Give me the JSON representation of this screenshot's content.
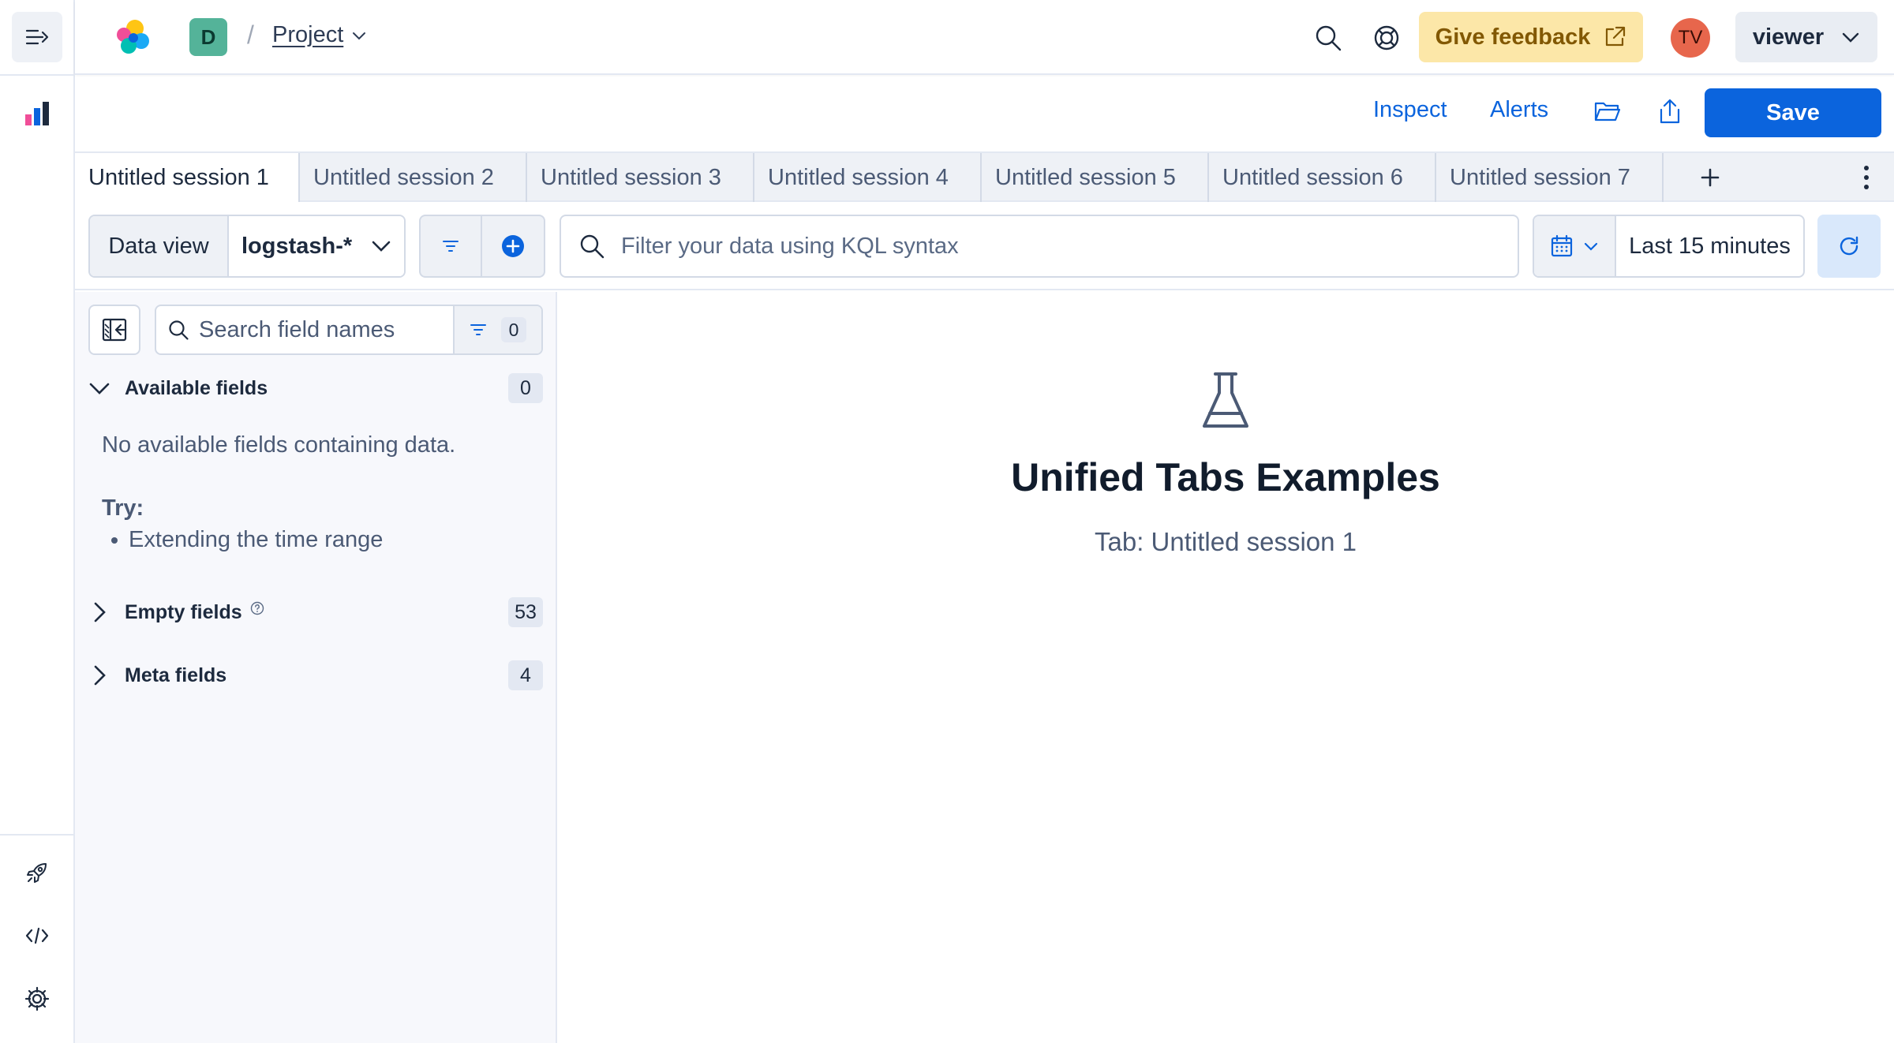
{
  "colors": {
    "accent": "#0b64dd",
    "feedback_bg": "#fce7a8",
    "feedback_text": "#825803",
    "avatar_space": "#54b399",
    "avatar_user": "#e7664c"
  },
  "rail": {
    "icons": [
      "menu-expand-icon",
      "discover-app-icon",
      "rocket-icon",
      "code-icon",
      "gear-icon"
    ]
  },
  "header": {
    "space_initial": "D",
    "breadcrumb_project": "Project",
    "feedback_label": "Give feedback",
    "user_initials": "TV",
    "role_label": "viewer"
  },
  "toolbar": {
    "inspect_label": "Inspect",
    "alerts_label": "Alerts",
    "save_label": "Save"
  },
  "tabs": [
    {
      "label": "Untitled session 1",
      "active": true
    },
    {
      "label": "Untitled session 2",
      "active": false
    },
    {
      "label": "Untitled session 3",
      "active": false
    },
    {
      "label": "Untitled session 4",
      "active": false
    },
    {
      "label": "Untitled session 5",
      "active": false
    },
    {
      "label": "Untitled session 6",
      "active": false
    },
    {
      "label": "Untitled session 7",
      "active": false
    }
  ],
  "query": {
    "data_view_label": "Data view",
    "data_view_value": "logstash-*",
    "kql_placeholder": "Filter your data using KQL syntax",
    "time_label": "Last 15 minutes"
  },
  "sidebar": {
    "search_placeholder": "Search field names",
    "filter_count": "0",
    "available": {
      "title": "Available fields",
      "count": "0"
    },
    "no_fields_text": "No available fields containing data.",
    "try_label": "Try:",
    "try_items": [
      "Extending the time range"
    ],
    "empty": {
      "title": "Empty fields",
      "count": "53"
    },
    "meta": {
      "title": "Meta fields",
      "count": "4"
    }
  },
  "main": {
    "title": "Unified Tabs Examples",
    "subtitle": "Tab: Untitled session 1"
  }
}
